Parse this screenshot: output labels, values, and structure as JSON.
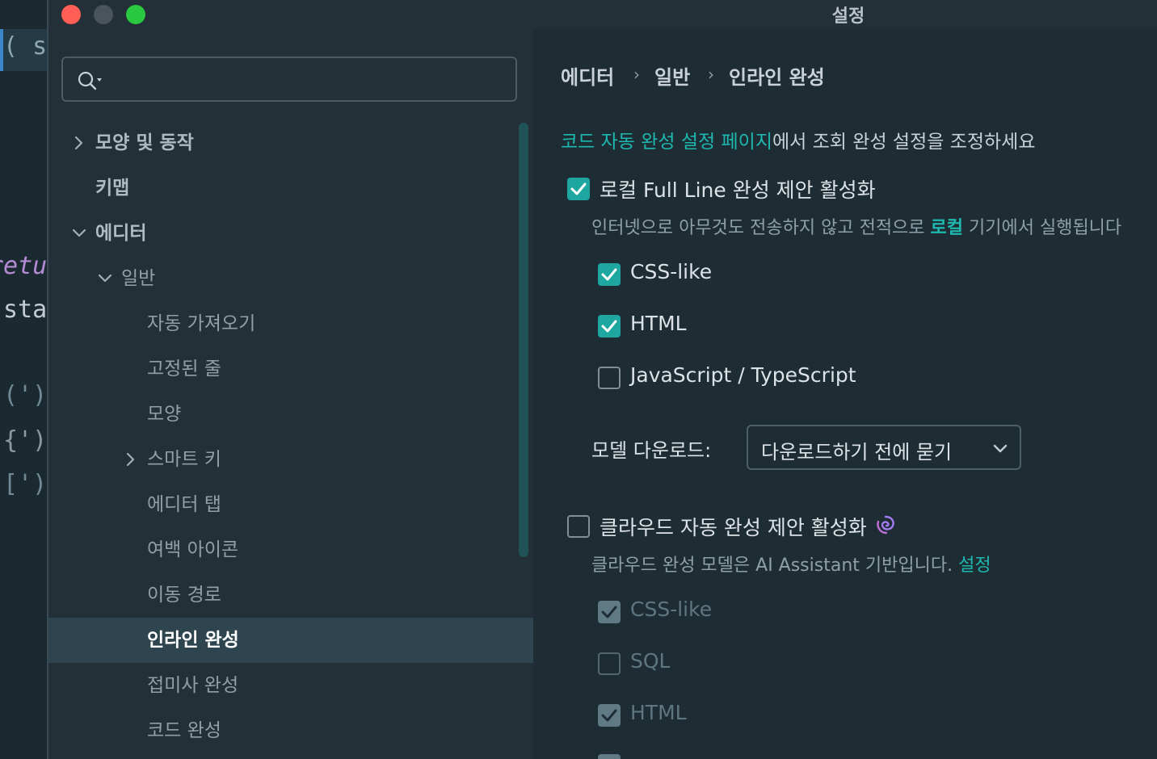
{
  "editor_background": {
    "lines": [
      "( sc",
      "retu",
      "sta",
      "(')",
      "{')",
      "[')"
    ]
  },
  "window": {
    "title": "설정"
  },
  "search": {
    "placeholder": ""
  },
  "nav": {
    "items": [
      {
        "label": "모양 및 동작",
        "expander": "collapsed"
      },
      {
        "label": "키맵",
        "expander": "none"
      },
      {
        "label": "에디터",
        "expander": "expanded"
      },
      {
        "label": "일반",
        "expander": "expanded"
      },
      {
        "label": "자동 가져오기",
        "expander": "none"
      },
      {
        "label": "고정된 줄",
        "expander": "none"
      },
      {
        "label": "모양",
        "expander": "none"
      },
      {
        "label": "스마트 키",
        "expander": "collapsed"
      },
      {
        "label": "에디터 탭",
        "expander": "none"
      },
      {
        "label": "여백 아이콘",
        "expander": "none"
      },
      {
        "label": "이동 경로",
        "expander": "none"
      },
      {
        "label": "인라인 완성",
        "expander": "none",
        "selected": true
      },
      {
        "label": "접미사 완성",
        "expander": "none"
      },
      {
        "label": "코드 완성",
        "expander": "none"
      }
    ]
  },
  "breadcrumb": {
    "items": [
      "에디터",
      "일반",
      "인라인 완성"
    ],
    "separator": "›"
  },
  "content": {
    "lead_link": "코드 자동 완성 설정 페이지",
    "lead_text": "에서 조회 완성 설정을 조정하세요",
    "local": {
      "label": "로컬 Full Line 완성 제안 활성화",
      "checked": true,
      "desc_before": "인터넷으로 아무것도 전송하지 않고 전적으로 ",
      "desc_highlight": "로컬",
      "desc_after": " 기기에서 실행됩니다",
      "languages": [
        {
          "label": "CSS-like",
          "checked": true
        },
        {
          "label": "HTML",
          "checked": true
        },
        {
          "label": "JavaScript / TypeScript",
          "checked": false
        }
      ]
    },
    "model_download": {
      "label": "모델 다운로드:",
      "value": "다운로드하기 전에 묻기"
    },
    "cloud": {
      "label": "클라우드 자동 완성 제안 활성화",
      "checked": false,
      "desc": "클라우드 완성 모델은 AI Assistant 기반입니다.",
      "desc_link": "설정",
      "languages": [
        {
          "label": "CSS-like",
          "checked": true
        },
        {
          "label": "SQL",
          "checked": false
        },
        {
          "label": "HTML",
          "checked": true
        }
      ]
    }
  },
  "colors": {
    "accent": "#1ea7a0",
    "link": "#1fb8b0",
    "selected_row": "#2e4550",
    "close": "#ff5f57",
    "maximize": "#28c840"
  }
}
